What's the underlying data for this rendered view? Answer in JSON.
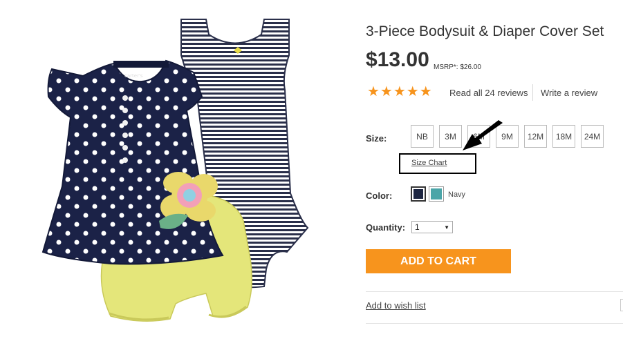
{
  "product": {
    "title": "3-Piece Bodysuit & Diaper Cover Set",
    "price": "$13.00",
    "msrp": "MSRP*: $26.00",
    "rating_stars": "★★★★★",
    "rating": 5,
    "reviews_link": "Read all 24 reviews",
    "write_review": "Write a review",
    "tag_text": "carter's"
  },
  "size": {
    "label": "Size:",
    "options": [
      "NB",
      "3M",
      "6M",
      "9M",
      "12M",
      "18M",
      "24M"
    ],
    "size_chart": "Size Chart"
  },
  "color": {
    "label": "Color:",
    "selected_name": "Navy",
    "swatches": [
      "#1c2541",
      "#4aa5a8"
    ]
  },
  "quantity": {
    "label": "Quantity:",
    "value": "1"
  },
  "actions": {
    "add_to_cart": "ADD TO CART",
    "wishlist": "Add to wish list"
  },
  "colors": {
    "accent": "#f7941d",
    "navy": "#1c2541",
    "yellow": "#e4e67a"
  }
}
